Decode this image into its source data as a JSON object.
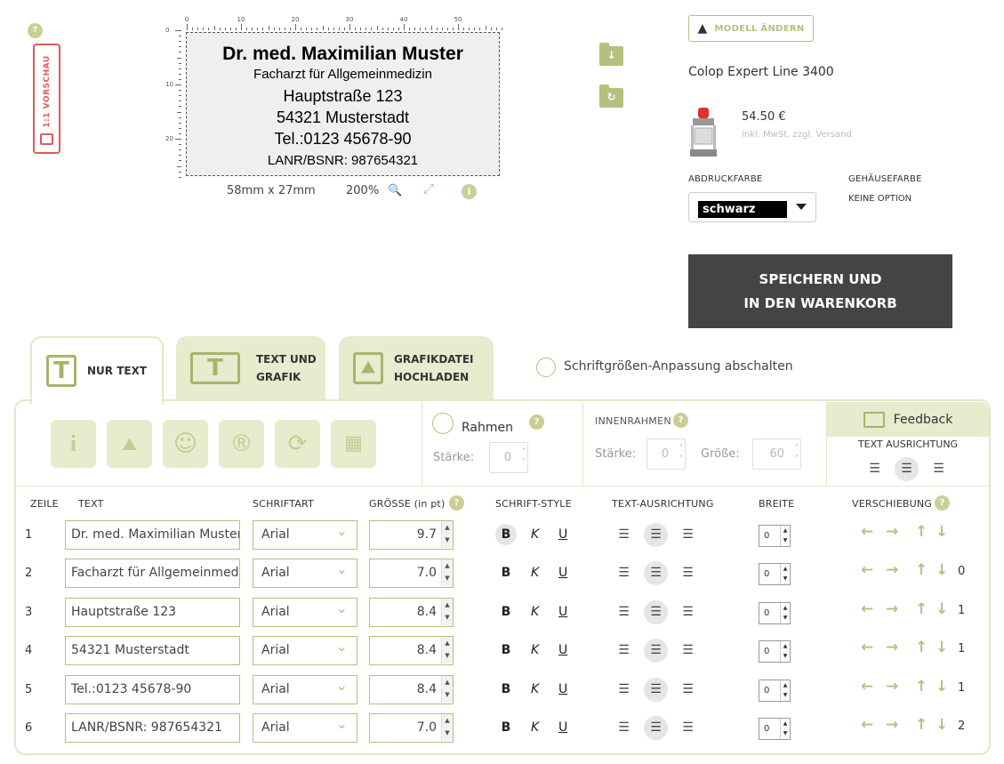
{
  "preview": {
    "toggle_label": "1:1 VORSCHAU",
    "help": "?",
    "ruler_top": [
      "0",
      "10",
      "20",
      "30",
      "40",
      "50"
    ],
    "ruler_left": [
      "0",
      "10",
      "20"
    ],
    "stamp_lines": [
      "Dr. med. Maximilian Muster",
      "Facharzt für Allgemeinmedizin",
      "Hauptstraße 123",
      "54321 Musterstadt",
      "Tel.:0123 45678-90",
      "LANR/BSNR: 987654321"
    ],
    "dimensions": "58mm x 27mm",
    "zoom": "200%",
    "info": "i"
  },
  "product": {
    "model_button": "MODELL ÄNDERN",
    "name": "Colop Expert Line 3400",
    "price": "54.50 €",
    "price_note": "inkl. MwSt. zzgl. Versand",
    "ink_label": "ABDRUCKFARBE",
    "ink_value": "schwarz",
    "housing_label": "GEHÄUSEFARBE",
    "housing_value": "KEINE OPTION",
    "save_line1": "SPEICHERN UND",
    "save_line2": "IN DEN WARENKORB"
  },
  "tabs": {
    "t1": "NUR TEXT",
    "t2a": "TEXT UND",
    "t2b": "GRAFIK",
    "t3a": "GRAFIKDATEI",
    "t3b": "HOCHLADEN",
    "font_adjust": "Schriftgrößen-Anpassung abschalten"
  },
  "frame": {
    "rahmen": "Rahmen",
    "staerke_label": "Stärke:",
    "staerke_value": "0",
    "innen_label": "INNENRAHMEN",
    "innen_staerke_label": "Stärke:",
    "innen_staerke_value": "0",
    "innen_groesse_label": "Größe:",
    "innen_groesse_value": "60",
    "feedback": "Feedback",
    "text_ausrichtung": "TEXT AUSRICHTUNG"
  },
  "table": {
    "headers": {
      "zeile": "ZEILE",
      "text": "TEXT",
      "font": "SCHRIFTART",
      "size": "GRÖSSE (in pt)",
      "style": "SCHRIFT-STYLE",
      "align": "TEXT-AUSRICHTUNG",
      "width": "BREITE",
      "shift": "VERSCHIEBUNG"
    },
    "rows": [
      {
        "no": "1",
        "text": "Dr. med. Maximilian Muster",
        "font": "Arial",
        "size": "9.7",
        "width": "0",
        "shift": ""
      },
      {
        "no": "2",
        "text": "Facharzt für Allgemeinmedizin",
        "font": "Arial",
        "size": "7.0",
        "width": "0",
        "shift": "0"
      },
      {
        "no": "3",
        "text": "Hauptstraße 123",
        "font": "Arial",
        "size": "8.4",
        "width": "0",
        "shift": "1"
      },
      {
        "no": "4",
        "text": "54321 Musterstadt",
        "font": "Arial",
        "size": "8.4",
        "width": "0",
        "shift": "1"
      },
      {
        "no": "5",
        "text": "Tel.:0123 45678-90",
        "font": "Arial",
        "size": "8.4",
        "width": "0",
        "shift": "1"
      },
      {
        "no": "6",
        "text": "LANR/BSNR: 987654321",
        "font": "Arial",
        "size": "7.0",
        "width": "0",
        "shift": "2"
      }
    ],
    "style_labels": {
      "bold": "B",
      "italic": "K",
      "underline": "U"
    }
  },
  "colors": {
    "accent": "#b5c07f",
    "tab_bg": "#e8ebcd",
    "dark_button": "#444444",
    "preview_red": "#e05a5a"
  }
}
